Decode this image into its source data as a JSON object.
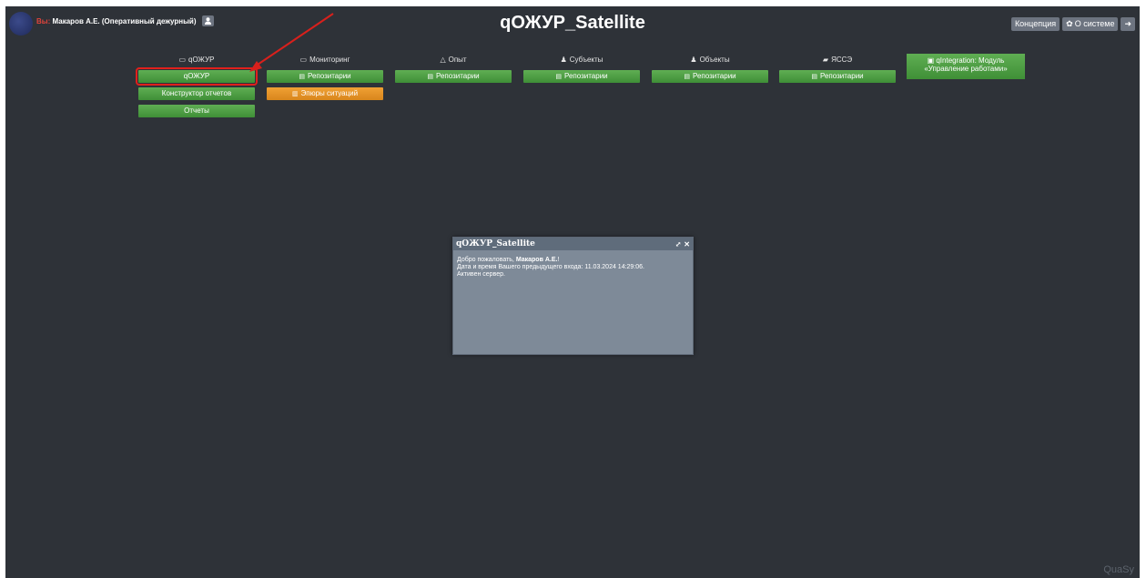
{
  "header": {
    "you_label": "Вы:",
    "user_name": "Макаров А.Е. (Оперативный дежурный)",
    "app_title": "qОЖУР_Satellite",
    "concept_btn": "Концепция",
    "about_btn": "О системе"
  },
  "columns": [
    {
      "head": "qОЖУР",
      "buttons": [
        "qОЖУР",
        "Конструктор отчетов",
        "Отчеты"
      ]
    },
    {
      "head": "Мониторинг",
      "buttons": [
        "Репозитарии",
        "Эпюры ситуаций"
      ]
    },
    {
      "head": "Опыт",
      "buttons": [
        "Репозитарии"
      ]
    },
    {
      "head": "Субъекты",
      "buttons": [
        "Репозитарии"
      ]
    },
    {
      "head": "Объекты",
      "buttons": [
        "Репозитарии"
      ]
    },
    {
      "head": "ЯССЭ",
      "buttons": [
        "Репозитарии"
      ]
    }
  ],
  "integration": {
    "line1": "qIntegration: Модуль",
    "line2": "«Управление работами»"
  },
  "dialog": {
    "title": "qОЖУР_Satellite",
    "welcome": "Добро пожаловать,",
    "user": "Макаров А.Е.",
    "excl": "!",
    "last_login": "Дата и время Вашего предыдущего входа: 11.03.2024 14:29:06.",
    "server": "Активен сервер."
  },
  "footer": {
    "brand": "QuaSy"
  },
  "colors": {
    "green": "#4a9a40",
    "orange": "#e5921f",
    "highlight": "#e0201c",
    "background": "#2e3238"
  }
}
